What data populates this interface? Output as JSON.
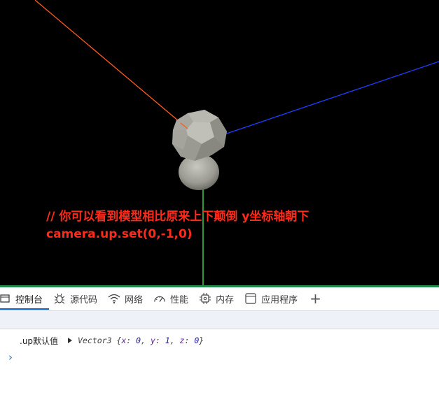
{
  "scene": {
    "background": "#000000",
    "annotation_line1": "// 你可以看到模型相比原来上下颠倒  y坐标轴朝下",
    "annotation_line2": "camera.up.set(0,-1,0)",
    "annotation_color": "#ff2a1a",
    "axis_colors": {
      "x": "#ff5a1f",
      "y": "#3fbf3f",
      "z": "#1f3fff"
    },
    "model_color": "#9a9a90"
  },
  "devtools": {
    "accent": "#0a62c7",
    "tabs": [
      {
        "label": "控制台",
        "icon": "console-icon",
        "active": true
      },
      {
        "label": "源代码",
        "icon": "bug-icon",
        "active": false
      },
      {
        "label": "网络",
        "icon": "wifi-icon",
        "active": false
      },
      {
        "label": "性能",
        "icon": "gauge-icon",
        "active": false
      },
      {
        "label": "内存",
        "icon": "chip-icon",
        "active": false
      },
      {
        "label": "应用程序",
        "icon": "app-window-icon",
        "active": false
      }
    ],
    "add_tab": "+"
  },
  "console": {
    "log_label": ".up默认值",
    "log_prefix": "Vector3 {",
    "log_x_key": "x",
    "log_x_val": "0",
    "log_y_key": "y",
    "log_y_val": "1",
    "log_z_key": "z",
    "log_z_val": "0",
    "log_suffix": "}",
    "prompt": "›"
  }
}
